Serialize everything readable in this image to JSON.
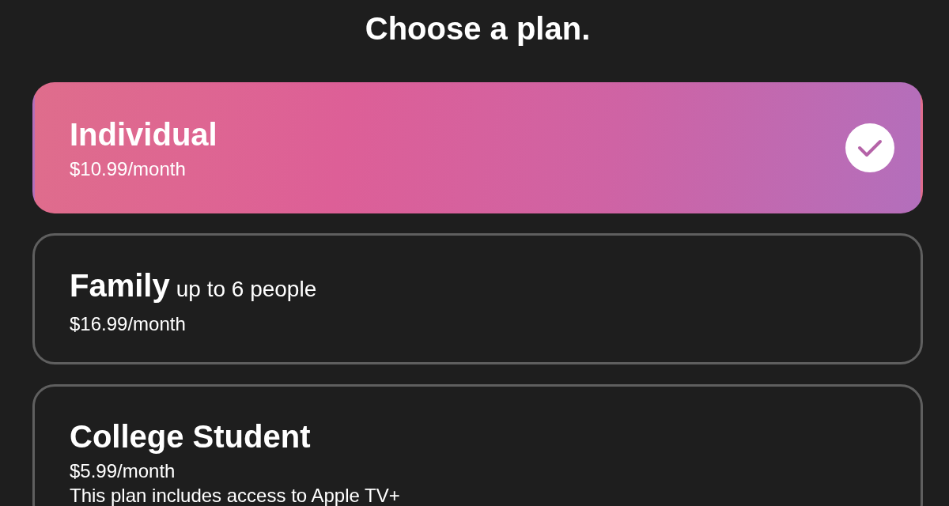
{
  "title": "Choose a plan.",
  "plans": [
    {
      "name": "Individual",
      "price": "$10.99/month",
      "selected": true
    },
    {
      "name": "Family",
      "subtitle": "up to 6 people",
      "price": "$16.99/month",
      "selected": false
    },
    {
      "name": "College Student",
      "price": "$5.99/month",
      "note": "This plan includes access to Apple TV+",
      "selected": false
    }
  ]
}
